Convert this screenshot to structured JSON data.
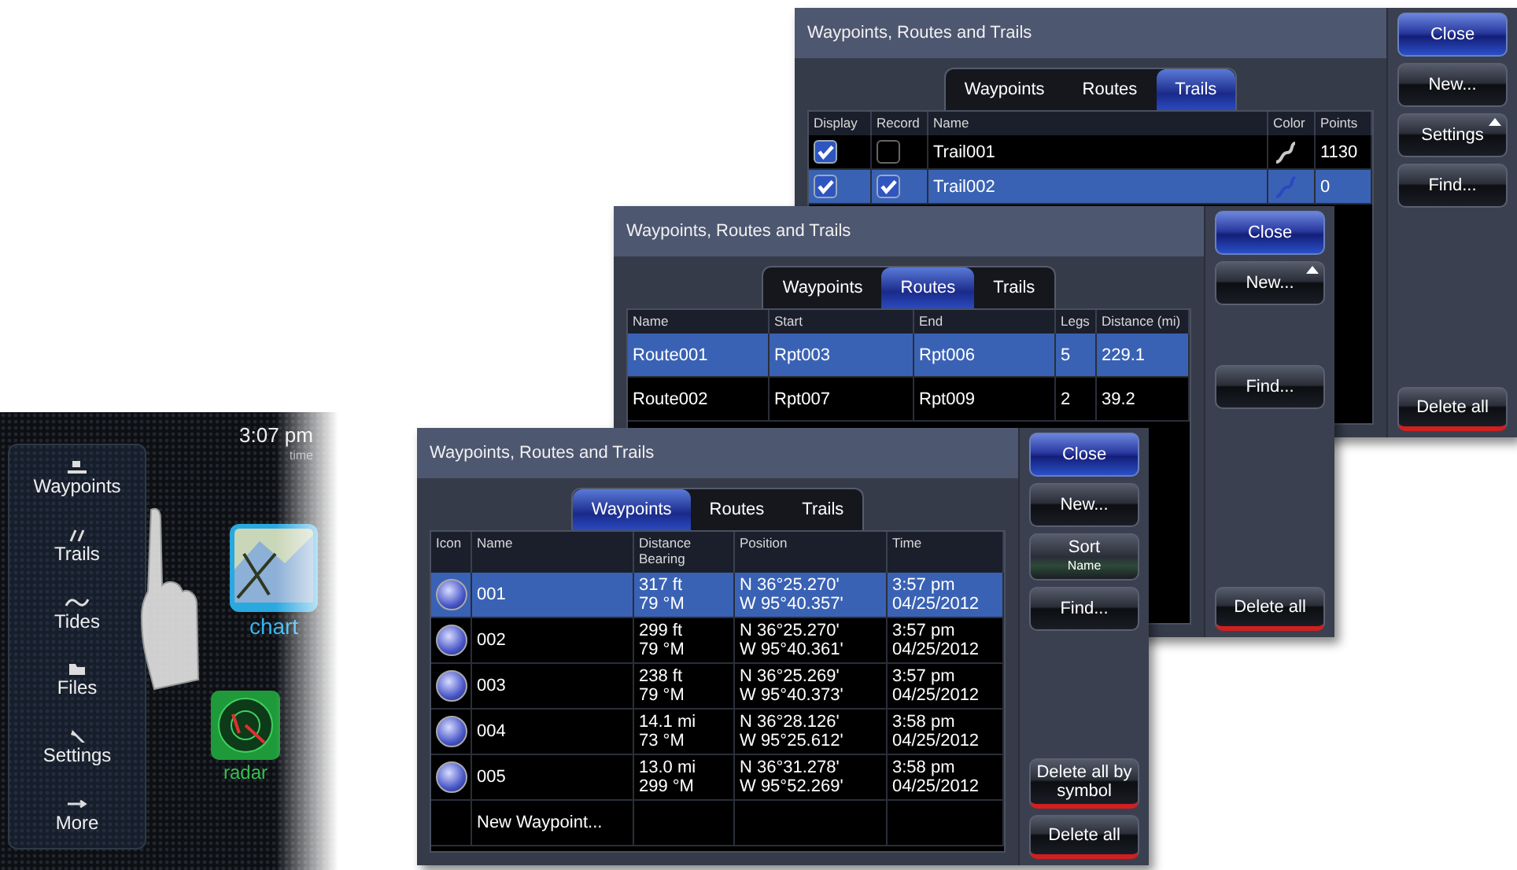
{
  "device": {
    "time": "3:07 pm",
    "time_caption": "time",
    "menu": [
      {
        "label": "Waypoints",
        "kind": "flag"
      },
      {
        "label": "Trails",
        "kind": "trail"
      },
      {
        "label": "Tides",
        "kind": "wave"
      },
      {
        "label": "Files",
        "kind": "folder"
      },
      {
        "label": "Settings",
        "kind": "wrench"
      },
      {
        "label": "More",
        "kind": "arrow"
      }
    ],
    "apps": [
      {
        "label": "chart",
        "kind": "chart"
      },
      {
        "label": "radar",
        "kind": "radar"
      }
    ]
  },
  "trails_window": {
    "title": "Waypoints, Routes and Trails",
    "tabs": [
      {
        "label": "Waypoints",
        "selected": false
      },
      {
        "label": "Routes",
        "selected": false
      },
      {
        "label": "Trails",
        "selected": true
      }
    ],
    "columns": [
      "Display",
      "Record",
      "Name",
      "Color",
      "Points"
    ],
    "rows": [
      {
        "display": true,
        "record": false,
        "name": "Trail001",
        "color": "#c8c8c8",
        "points": "1130",
        "selected": false
      },
      {
        "display": true,
        "record": true,
        "name": "Trail002",
        "color": "#2a48c0",
        "points": "0",
        "selected": true
      }
    ],
    "buttons": [
      {
        "label": "Close",
        "kind": "close",
        "has_menu": false
      },
      {
        "label": "New...",
        "kind": "normal",
        "has_menu": false
      },
      {
        "label": "Settings",
        "kind": "normal",
        "has_menu": true
      },
      {
        "label": "Find...",
        "kind": "normal",
        "has_menu": false
      },
      {
        "label": "Delete all",
        "kind": "delete",
        "has_menu": false
      }
    ]
  },
  "routes_window": {
    "title": "Waypoints, Routes and Trails",
    "tabs": [
      {
        "label": "Waypoints",
        "selected": false
      },
      {
        "label": "Routes",
        "selected": true
      },
      {
        "label": "Trails",
        "selected": false
      }
    ],
    "columns": [
      "Name",
      "Start",
      "End",
      "Legs",
      "Distance (mi)"
    ],
    "rows": [
      {
        "name": "Route001",
        "start": "Rpt003",
        "end": "Rpt006",
        "legs": "5",
        "distance": "229.1",
        "selected": true
      },
      {
        "name": "Route002",
        "start": "Rpt007",
        "end": "Rpt009",
        "legs": "2",
        "distance": "39.2",
        "selected": false
      }
    ],
    "buttons": [
      {
        "label": "Close",
        "kind": "close",
        "has_menu": false
      },
      {
        "label": "New...",
        "kind": "normal",
        "has_menu": true
      },
      {
        "label": "Find...",
        "kind": "normal",
        "has_menu": false
      },
      {
        "label": "Delete all",
        "kind": "delete",
        "has_menu": false
      }
    ]
  },
  "waypoints_window": {
    "title": "Waypoints, Routes and Trails",
    "tabs": [
      {
        "label": "Waypoints",
        "selected": true
      },
      {
        "label": "Routes",
        "selected": false
      },
      {
        "label": "Trails",
        "selected": false
      }
    ],
    "columns": [
      "Icon",
      "Name",
      "Distance Bearing",
      "Position",
      "Time"
    ],
    "rows": [
      {
        "name": "001",
        "distance": "317 ft",
        "bearing": "79 °M",
        "latitude": "N  36°25.270'",
        "longitude": "W  95°40.357'",
        "time": "3:57 pm",
        "date": "04/25/2012",
        "selected": true
      },
      {
        "name": "002",
        "distance": "299 ft",
        "bearing": "79 °M",
        "latitude": "N  36°25.270'",
        "longitude": "W  95°40.361'",
        "time": "3:57 pm",
        "date": "04/25/2012",
        "selected": false
      },
      {
        "name": "003",
        "distance": "238 ft",
        "bearing": "79 °M",
        "latitude": "N  36°25.269'",
        "longitude": "W  95°40.373'",
        "time": "3:57 pm",
        "date": "04/25/2012",
        "selected": false
      },
      {
        "name": "004",
        "distance": "14.1 mi",
        "bearing": "73 °M",
        "latitude": "N  36°28.126'",
        "longitude": "W  95°25.612'",
        "time": "3:58 pm",
        "date": "04/25/2012",
        "selected": false
      },
      {
        "name": "005",
        "distance": "13.0 mi",
        "bearing": "299 °M",
        "latitude": "N  36°31.278'",
        "longitude": "W  95°52.269'",
        "time": "3:58 pm",
        "date": "04/25/2012",
        "selected": false
      }
    ],
    "new_row_label": "New Waypoint...",
    "buttons": [
      {
        "label": "Close",
        "kind": "close",
        "has_menu": false
      },
      {
        "label": "New...",
        "kind": "normal",
        "has_menu": false
      },
      {
        "label": "Sort",
        "sub_label": "Name",
        "kind": "sort",
        "has_menu": false
      },
      {
        "label": "Find...",
        "kind": "normal",
        "has_menu": false
      },
      {
        "label": "Delete all by symbol",
        "kind": "delete",
        "has_menu": false
      },
      {
        "label": "Delete all",
        "kind": "delete",
        "has_menu": false
      }
    ]
  }
}
